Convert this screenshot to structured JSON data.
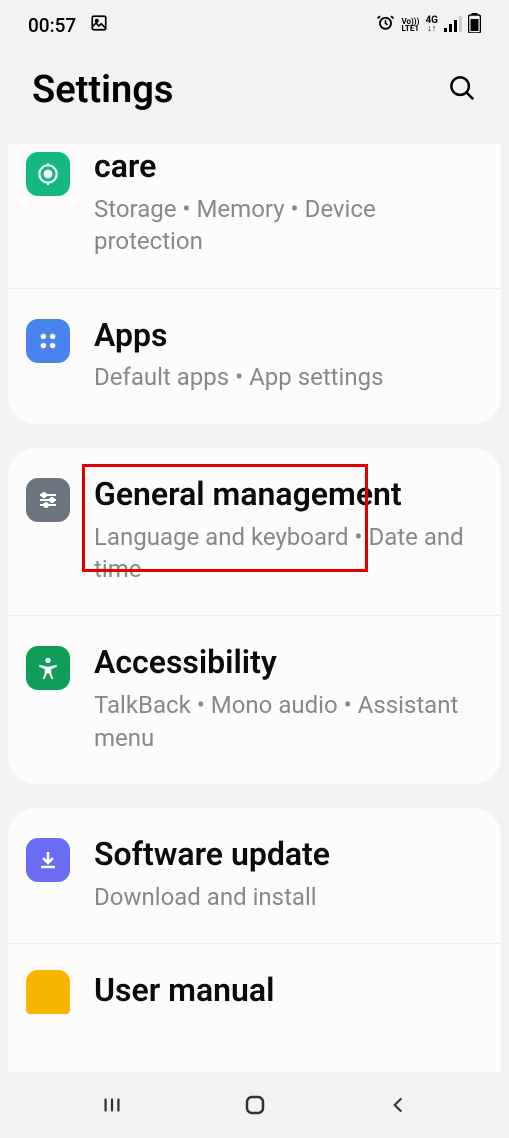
{
  "status": {
    "time": "00:57",
    "lte_label": "LTE1",
    "network": "4G",
    "volte": "Vo)))"
  },
  "header": {
    "title": "Settings"
  },
  "items": {
    "care": {
      "title": "care",
      "sub": "Storage  •  Memory  •  Device protection"
    },
    "apps": {
      "title": "Apps",
      "sub": "Default apps  •  App settings"
    },
    "general": {
      "title": "General management",
      "sub": "Language and keyboard  •  Date and time"
    },
    "accessibility": {
      "title": "Accessibility",
      "sub": "TalkBack  •  Mono audio  •  Assistant menu"
    },
    "update": {
      "title": "Software update",
      "sub": "Download and install"
    },
    "manual": {
      "title": "User manual"
    }
  }
}
